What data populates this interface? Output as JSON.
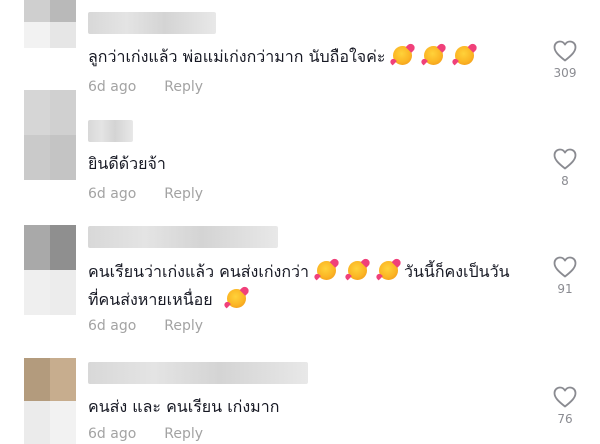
{
  "comments": [
    {
      "text_parts": [
        "ลูกว่าเก่งแล้ว พ่อแม่เก่งกว่ามาก นับถือใจค่ะ"
      ],
      "emoji_count": 3,
      "time": "6d ago",
      "reply": "Reply",
      "likes": "309"
    },
    {
      "text_parts": [
        "ยินดีด้วยจ้า"
      ],
      "emoji_count": 0,
      "time": "6d ago",
      "reply": "Reply",
      "likes": "8"
    },
    {
      "line1": "คนเรียนว่าเก่งแล้ว คนส่งเก่งกว่า",
      "line1_tail": "วันนี้ก็คงเป็นวัน",
      "line2": "ที่คนส่งหายเหนื่อย",
      "time": "6d ago",
      "reply": "Reply",
      "likes": "91"
    },
    {
      "text_parts": [
        "คนส่ง และ คนเรียน เก่งมาก"
      ],
      "emoji_count": 0,
      "time": "6d ago",
      "reply": "Reply",
      "likes": "76"
    }
  ],
  "emoji_icon": "smiling-face-with-hearts-icon",
  "like_icon": "heart-outline-icon"
}
